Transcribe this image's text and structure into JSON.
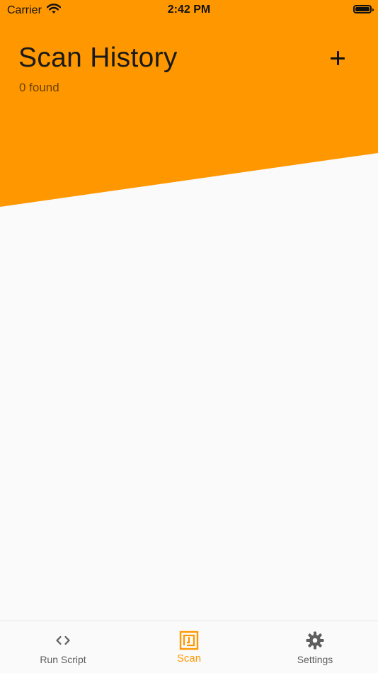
{
  "status_bar": {
    "carrier": "Carrier",
    "time": "2:42 PM"
  },
  "header": {
    "title": "Scan History",
    "subtitle": "0 found",
    "add_icon": "plus-icon"
  },
  "tabs": [
    {
      "label": "Run Script",
      "icon": "code-icon",
      "active": false
    },
    {
      "label": "Scan",
      "icon": "nfc-icon",
      "active": true
    },
    {
      "label": "Settings",
      "icon": "gear-icon",
      "active": false
    }
  ],
  "colors": {
    "accent": "#ff9800",
    "background": "#fafafa",
    "inactive_tab": "#5e5e5e"
  }
}
